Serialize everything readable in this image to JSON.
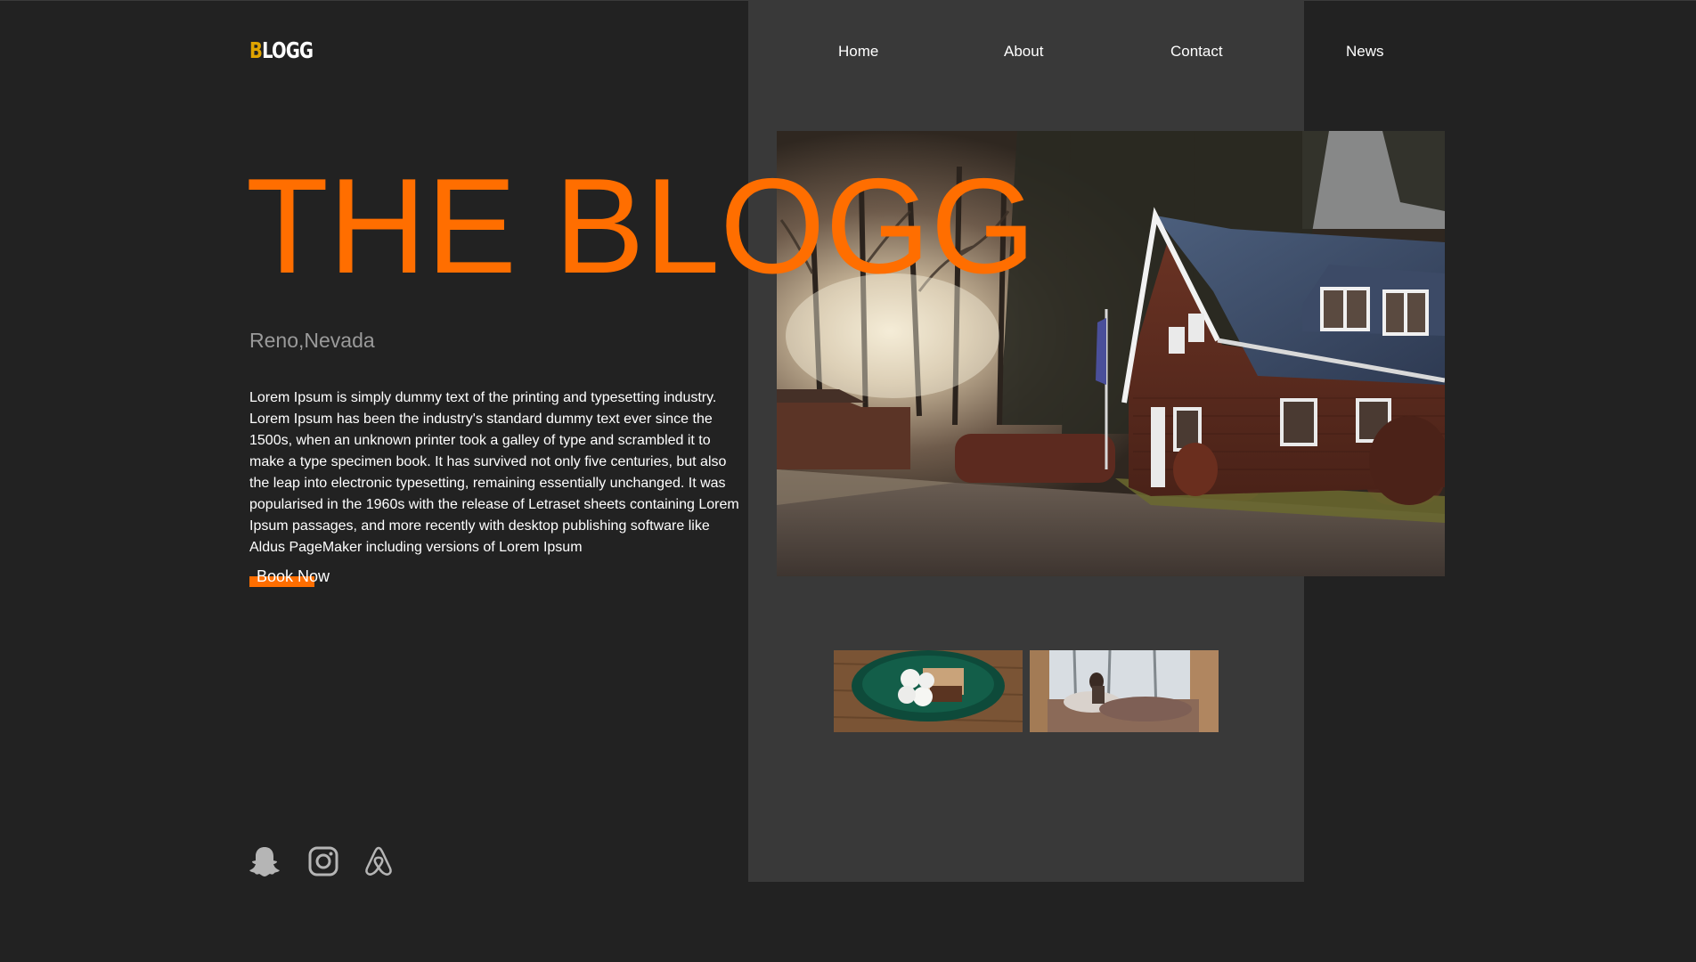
{
  "brand": {
    "logo_first": "B",
    "logo_rest": "LOGG",
    "logo_accent": "#e0a400"
  },
  "nav": {
    "items": [
      {
        "label": "Home"
      },
      {
        "label": "About"
      },
      {
        "label": "Contact"
      },
      {
        "label": "News"
      }
    ]
  },
  "hero": {
    "title": "THE BLOGG",
    "title_color": "#ff6e00",
    "location": "Reno,Nevada",
    "body": "Lorem Ipsum is simply dummy text of the printing and typesetting industry. Lorem Ipsum has been the industry's standard dummy text ever since the 1500s, when an unknown printer took a galley of type and scrambled it to make a type specimen book. It has survived not only five centuries, but also the leap into electronic typesetting, remaining essentially unchanged. It was popularised in the 1960s with the release of Letraset sheets containing Lorem Ipsum passages, and more recently with desktop publishing software like Aldus PageMaker including versions of Lorem Ipsum",
    "cta_label": "Book Now"
  },
  "images": {
    "main": "house-in-forest-photo",
    "thumbnails": [
      "smores-plate-photo",
      "cabin-bed-window-photo"
    ]
  },
  "social": {
    "icons": [
      "snapchat-icon",
      "instagram-icon",
      "airbnb-icon"
    ]
  },
  "colors": {
    "background": "#222222",
    "panel": "#393939",
    "accent": "#ff6e00"
  }
}
